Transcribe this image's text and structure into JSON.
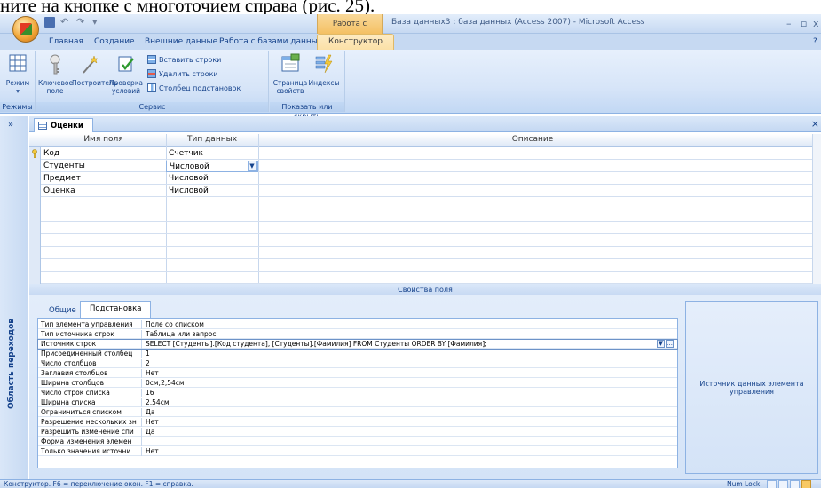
{
  "doc_top_text": "ните на кнопке с многоточием справа (рис. 25).",
  "titlebar": {
    "context_tab_group": "Работа с таблицами",
    "window_title": "База данных3 : база данных (Access 2007) - Microsoft Access",
    "minimize": "–",
    "maximize": "▫",
    "close": "x"
  },
  "ribbon_tabs": [
    {
      "label": "Главная"
    },
    {
      "label": "Создание"
    },
    {
      "label": "Внешние данные"
    },
    {
      "label": "Работа с базами данных"
    },
    {
      "label": "Конструктор"
    }
  ],
  "ribbon": {
    "groups": {
      "views": {
        "label": "Режимы",
        "view_button": "Режим"
      },
      "tools": {
        "label": "Сервис",
        "primary_key": "Ключевое поле",
        "builder": "Построитель",
        "test_rules": "Проверка условий",
        "insert_rows": "Вставить строки",
        "delete_rows": "Удалить строки",
        "lookup_column": "Столбец подстановок"
      },
      "show_hide": {
        "label": "Показать или скрыть",
        "property_sheet": "Страница свойств",
        "indexes": "Индексы"
      }
    }
  },
  "nav_pane": {
    "label": "Область переходов",
    "toggle": "»"
  },
  "doc_tab": {
    "label": "Оценки",
    "close": "×"
  },
  "grid": {
    "headers": {
      "field_name": "Имя поля",
      "data_type": "Тип данных",
      "description": "Описание"
    },
    "rows": [
      {
        "field_name": "Код",
        "data_type": "Счетчик",
        "primary_key": true
      },
      {
        "field_name": "Студенты",
        "data_type": "Числовой",
        "selected": true
      },
      {
        "field_name": "Предмет",
        "data_type": "Числовой"
      },
      {
        "field_name": "Оценка",
        "data_type": "Числовой"
      }
    ]
  },
  "field_properties": {
    "header": "Свойства поля",
    "tabs": [
      {
        "label": "Общие"
      },
      {
        "label": "Подстановка",
        "active": true
      }
    ],
    "rows": [
      {
        "label": "Тип элемента управления",
        "value": "Поле со списком"
      },
      {
        "label": "Тип источника строк",
        "value": "Таблица или запрос"
      },
      {
        "label": "Источник строк",
        "value": "SELECT [Студенты].[Код студента], [Студенты].[Фамилия] FROM Студенты ORDER BY [Фамилия];",
        "selected": true
      },
      {
        "label": "Присоединенный столбец",
        "value": "1"
      },
      {
        "label": "Число столбцов",
        "value": "2"
      },
      {
        "label": "Заглавия столбцов",
        "value": "Нет"
      },
      {
        "label": "Ширина столбцов",
        "value": "0см;2,54см"
      },
      {
        "label": "Число строк списка",
        "value": "16"
      },
      {
        "label": "Ширина списка",
        "value": "2,54см"
      },
      {
        "label": "Ограничиться списком",
        "value": "Да"
      },
      {
        "label": "Разрешение нескольких зн",
        "value": "Нет"
      },
      {
        "label": "Разрешить изменение спи",
        "value": "Да"
      },
      {
        "label": "Форма изменения элемен",
        "value": ""
      },
      {
        "label": "Только значения источни",
        "value": "Нет"
      }
    ],
    "help_text": "Источник данных элемента управления"
  },
  "statusbar": {
    "text": "Конструктор.  F6 = переключение окон.  F1 = справка.",
    "numlock": "Num Lock"
  }
}
